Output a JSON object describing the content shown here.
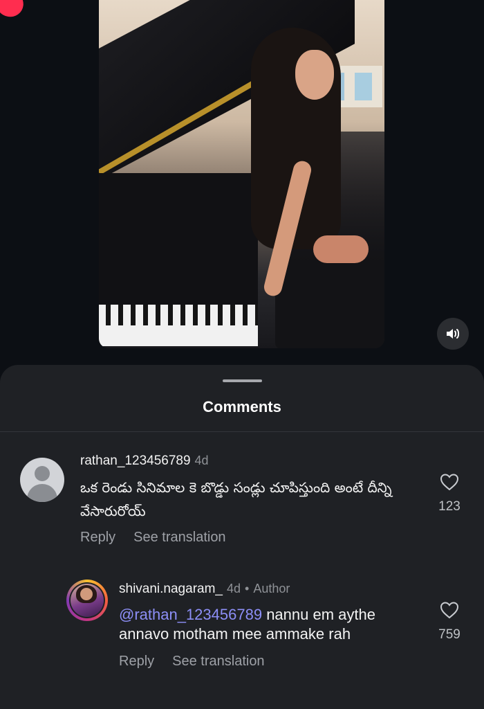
{
  "media": {
    "speaker_icon": "speaker-icon"
  },
  "comments_sheet": {
    "title": "Comments",
    "comments": [
      {
        "username": "rathan_123456789",
        "time": "4d",
        "text": "ఒక రెండు సినిమాల కె బొడ్డు సండ్లు చూపిస్తుంది అంటే దీన్ని వేసారురోయ్",
        "likes": "123",
        "reply_label": "Reply",
        "translate_label": "See translation"
      },
      {
        "username": "shivani.nagaram_",
        "time": "4d",
        "separator": "•",
        "author_badge": "Author",
        "mention": "@rathan_123456789",
        "text": " nannu  em aythe annavo motham mee ammake rah",
        "likes": "759",
        "reply_label": "Reply",
        "translate_label": "See translation"
      }
    ]
  }
}
